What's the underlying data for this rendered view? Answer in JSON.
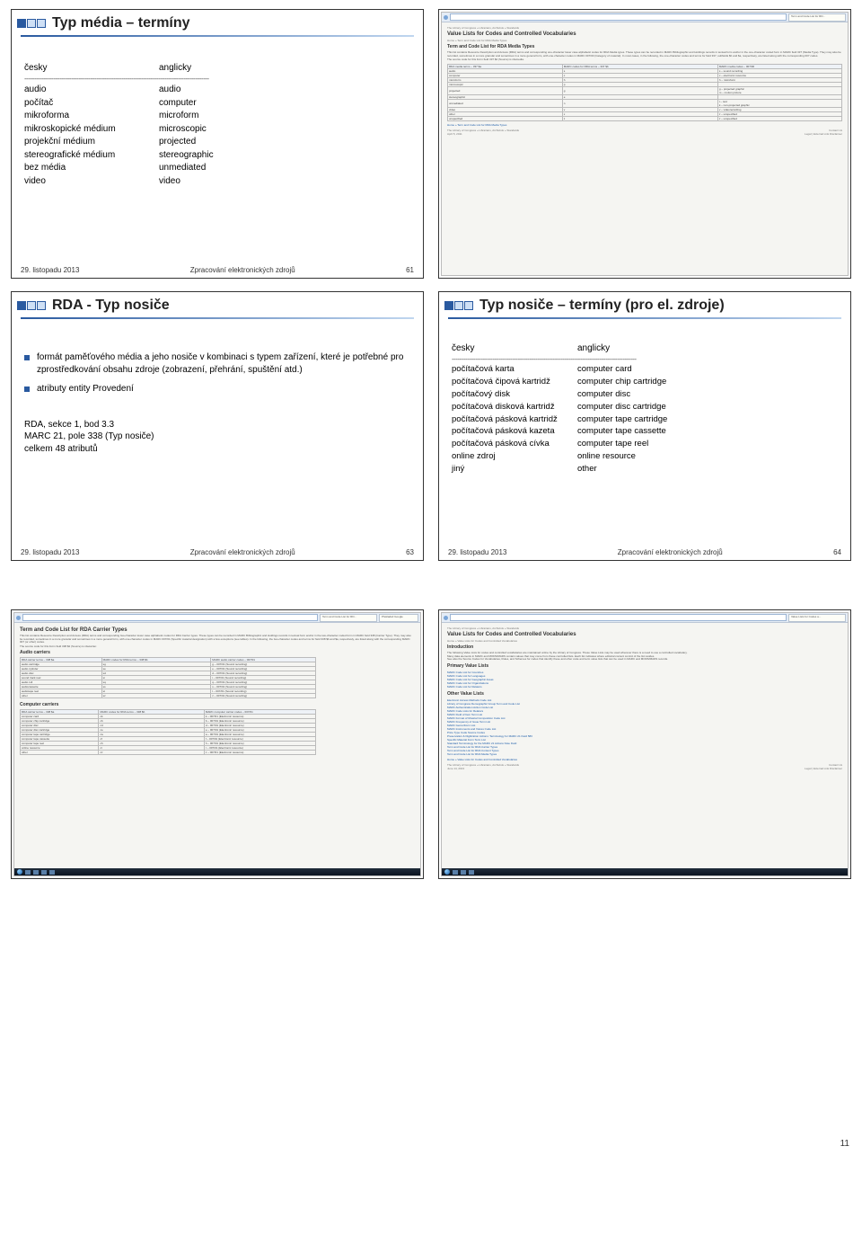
{
  "page_number": "11",
  "slide61": {
    "title": "Typ média – termíny",
    "header_cz": "česky",
    "header_en": "anglicky",
    "rows": [
      [
        "audio",
        "audio"
      ],
      [
        "počítač",
        "computer"
      ],
      [
        "mikroforma",
        "microform"
      ],
      [
        "mikroskopické médium",
        "microscopic"
      ],
      [
        "projekční médium",
        "projected"
      ],
      [
        "stereografické médium",
        "stereographic"
      ],
      [
        "bez média",
        "unmediated"
      ],
      [
        "video",
        "video"
      ]
    ],
    "footer_date": "29. listopadu 2013",
    "footer_mid": "Zpracování elektronických zdrojů",
    "footer_num": "61"
  },
  "slide62_shot": {
    "crumb": "The Library of Congress » Librarians, Archivists » Standards",
    "h1": "Value Lists for Codes and Controlled Vocabularies",
    "h2": "Term and Code List for RDA Media Types",
    "breadcrumb2": "Home » Term and Code List for RDA Media Types",
    "intro": "This list contains Resource Description and Access (RDA) terms and corresponding one-character lower case alphabetic codes for RDA Media types. These types can be recorded in MARC Bibliographic and Holdings records in textual form and/or in the one-character coded form in MARC field 337 (Media Type). They may also be recorded, sometimes in a more granular and sometimes in a more general form, with one-character codes in MARC 007/00 (Category of material). In most cases, in the following, the one-character codes and terms for field 337, subfields $b and $a, respectively, are listed along with the corresponding 007 codes.",
    "source_line": "The source code for this list in field 337 $2 (Source) is rdamedia.",
    "th1": "RDA media terms – 337 $a",
    "th2": "MARC codes for RDA terms – 337 $b",
    "th3": "MARC media codes – 007/00",
    "rows": [
      [
        "audio",
        "s",
        "s – sound recording"
      ],
      [
        "computer",
        "c",
        "c – electronic resource"
      ],
      [
        "microform",
        "h",
        "h – microform"
      ],
      [
        "microscopic",
        "p",
        ""
      ],
      [
        "projected",
        "g",
        "g – projected graphic\nm – motion picture"
      ],
      [
        "stereographic",
        "e",
        ""
      ],
      [
        "unmediated",
        "n",
        "t – text\nk – non-projected graphic"
      ],
      [
        "video",
        "v",
        "v – videorecording"
      ],
      [
        "other",
        "x",
        "z – unspecified"
      ],
      [
        "unspecified",
        "z",
        "z – unspecified"
      ]
    ],
    "back_link": "Home » Term and Code List for RDA Media Types",
    "footer_left": "The Library of Congress » Librarians, Archivists » Standards\nApril 5, 2011",
    "footer_right": "Contact Us\nLegal | External Link Disclaimer"
  },
  "slide63": {
    "title": "RDA - Typ nosiče",
    "b1": "formát paměťového média a jeho nosiče v kombinaci s typem zařízení, které je potřebné pro zprostředkování obsahu zdroje (zobrazení, přehrání, spuštění atd.)",
    "b2": "atributy entity Provedení",
    "ref1": "RDA, sekce 1, bod 3.3",
    "ref2": "MARC 21, pole 338 (Typ nosiče)",
    "ref3": "celkem 48 atributů",
    "footer_date": "29. listopadu 2013",
    "footer_mid": "Zpracování elektronických zdrojů",
    "footer_num": "63"
  },
  "slide64": {
    "title": "Typ nosiče – termíny (pro el. zdroje)",
    "header_cz": "česky",
    "header_en": "anglicky",
    "rows": [
      [
        "počítačová karta",
        "computer card"
      ],
      [
        "počítačová čipová kartridž",
        "computer chip cartridge"
      ],
      [
        "počítačový disk",
        "computer disc"
      ],
      [
        "počítačová disková kartridž",
        "computer disc cartridge"
      ],
      [
        "počítačová pásková kartridž",
        "computer tape cartridge"
      ],
      [
        "počítačová pásková kazeta",
        "computer tape cassette"
      ],
      [
        "počítačová pásková cívka",
        "computer tape reel"
      ],
      [
        "online zdroj",
        "online resource"
      ],
      [
        "jiný",
        "other"
      ]
    ],
    "footer_date": "29. listopadu 2013",
    "footer_mid": "Zpracování elektronických zdrojů",
    "footer_num": "64"
  },
  "slide65_shot": {
    "h1": "Term and Code List for RDA Carrier Types",
    "intro": "This list contains Resource Description and Access (RDA) terms and corresponding two-character lower case alphabetic codes for RDA Carrier types. These types can be recorded in MARC Bibliographic and Holdings records in textual form and/or in the two-character coded form in MARC field 338 (Carrier Type). They may also be recorded, sometimes in a more granular and sometimes in a more general form, with one-character codes in MARC 007/01 (Specific material designation) with a few exceptions (see tables). In the following, the two-character codes and terms for field 338 $b and $a, respectively, are listed along with the corresponding MARC 007 (or other) codes.",
    "source_line": "The source code for this list in field 338 $2 (Source) is rdacarrier.",
    "sec_audio": "Audio carriers",
    "th_a1": "RDA carrier terms – 338 $a",
    "th_a2": "MARC codes for RDA terms – 338 $b",
    "th_a3": "MARC audio carrier codes – 007/01",
    "audio_rows": [
      [
        "audio cartridge",
        "sg",
        "g – 007/01 (Sound recording)"
      ],
      [
        "audio cylinder",
        "se",
        "e – 007/01 (Sound recording)"
      ],
      [
        "audio disc",
        "sd",
        "d – 007/01 (Sound recording)"
      ],
      [
        "sound track reel",
        "si",
        "i – 007/01 (Sound recording)"
      ],
      [
        "audio roll",
        "sq",
        "q – 007/01 (Sound recording)"
      ],
      [
        "audiocassette",
        "ss",
        "s – 007/01 (Sound recording)"
      ],
      [
        "audiotape reel",
        "st",
        "t – 007/01 (Sound recording)"
      ],
      [
        "other",
        "sz",
        "z – 007/01 (Sound recording)"
      ]
    ],
    "sec_comp": "Computer carriers",
    "th_c1": "RDA carrier terms – 338 $a",
    "th_c2": "MARC codes for RDA terms – 338 $b",
    "th_c3": "MARC computer carrier codes – 007/01",
    "comp_rows": [
      [
        "computer card",
        "ck",
        "k – 007/01 (Electronic resource)"
      ],
      [
        "computer chip cartridge",
        "cb",
        "b – 007/01 (Electronic resource)"
      ],
      [
        "computer disc",
        "cd",
        "d – 007/01 (Electronic resource)"
      ],
      [
        "computer disc cartridge",
        "ce",
        "e – 007/01 (Electronic resource)"
      ],
      [
        "computer tape cartridge",
        "ca",
        "a – 007/01 (Electronic resource)"
      ],
      [
        "computer tape cassette",
        "cf",
        "f – 007/01 (Electronic resource)"
      ],
      [
        "computer tape reel",
        "ch",
        "h – 007/01 (Electronic resource)"
      ],
      [
        "online resource",
        "cr",
        "r – 007/01 (Electronic resource)"
      ],
      [
        "other",
        "cz",
        "z – 007/01 (Electronic resource)"
      ]
    ]
  },
  "slide66_shot": {
    "crumb": "The Library of Congress » Librarians, Archivists » Standards",
    "h1": "Value Lists for Codes and Controlled Vocabularies",
    "breadcrumb2": "Home » Value Lists for Codes and Controlled Vocabularies",
    "sec_intro_h": "Introduction",
    "intro": "The following Value Lists for codes and controlled vocabularies are maintained online by the Library of Congress. These Value Lists may be used wherever there is a need to use a controlled vocabulary.\nMany data elements in MARC and MODS/MADS contain values that may come from these controlled lists. Each list indicates where editorial content control of the list resides.\nSee also the Source Codes for Vocabularies, Rules, and Schemes for codes that identify these and other code and term value lists that can be used in MARC and MODS/MADS records.",
    "sec_primary": "Primary Value Lists",
    "primary_items": [
      "MARC Code List for Countries",
      "MARC Code List for Languages",
      "MARC Code List for Geographic Areas",
      "MARC Code List for Organizations",
      "MARC Code List for Relators"
    ],
    "sec_other": "Other Value Lists",
    "other_items": [
      "Electronic Access Methods Code List",
      "Library of Congress Demographic Group Term and Code List",
      "MARC Authentication Action Code List",
      "MARC Code Lists for Relators",
      "MARC Field of Item Term List",
      "MARC Format of Musical Composition Code List",
      "MARC Frequency of Issue Term List",
      "MARC Genre/Form List",
      "MARC Instruments and Voices Code List",
      "Price Type Code Source Codes",
      "Preservation & Digitization Actions: Terminology for MARC 21 Field 583",
      "Specific Material Form Term List",
      "Standard Terminology for the MARC 21 Actions Note Field",
      "Term and Code List for RDA Carrier Types",
      "Term and Code List for RDA Content Types",
      "Term and Code List for RDA Media Types"
    ],
    "back_link": "Home » Value Lists for Codes and Controlled Vocabularies",
    "footer_left": "The Library of Congress » Librarians, Archivists » Standards\nJune 14, 2013",
    "footer_right": "Contact Us\nLegal | External Link Disclaimer",
    "tab_label": "Value Lists for Codes a..."
  }
}
